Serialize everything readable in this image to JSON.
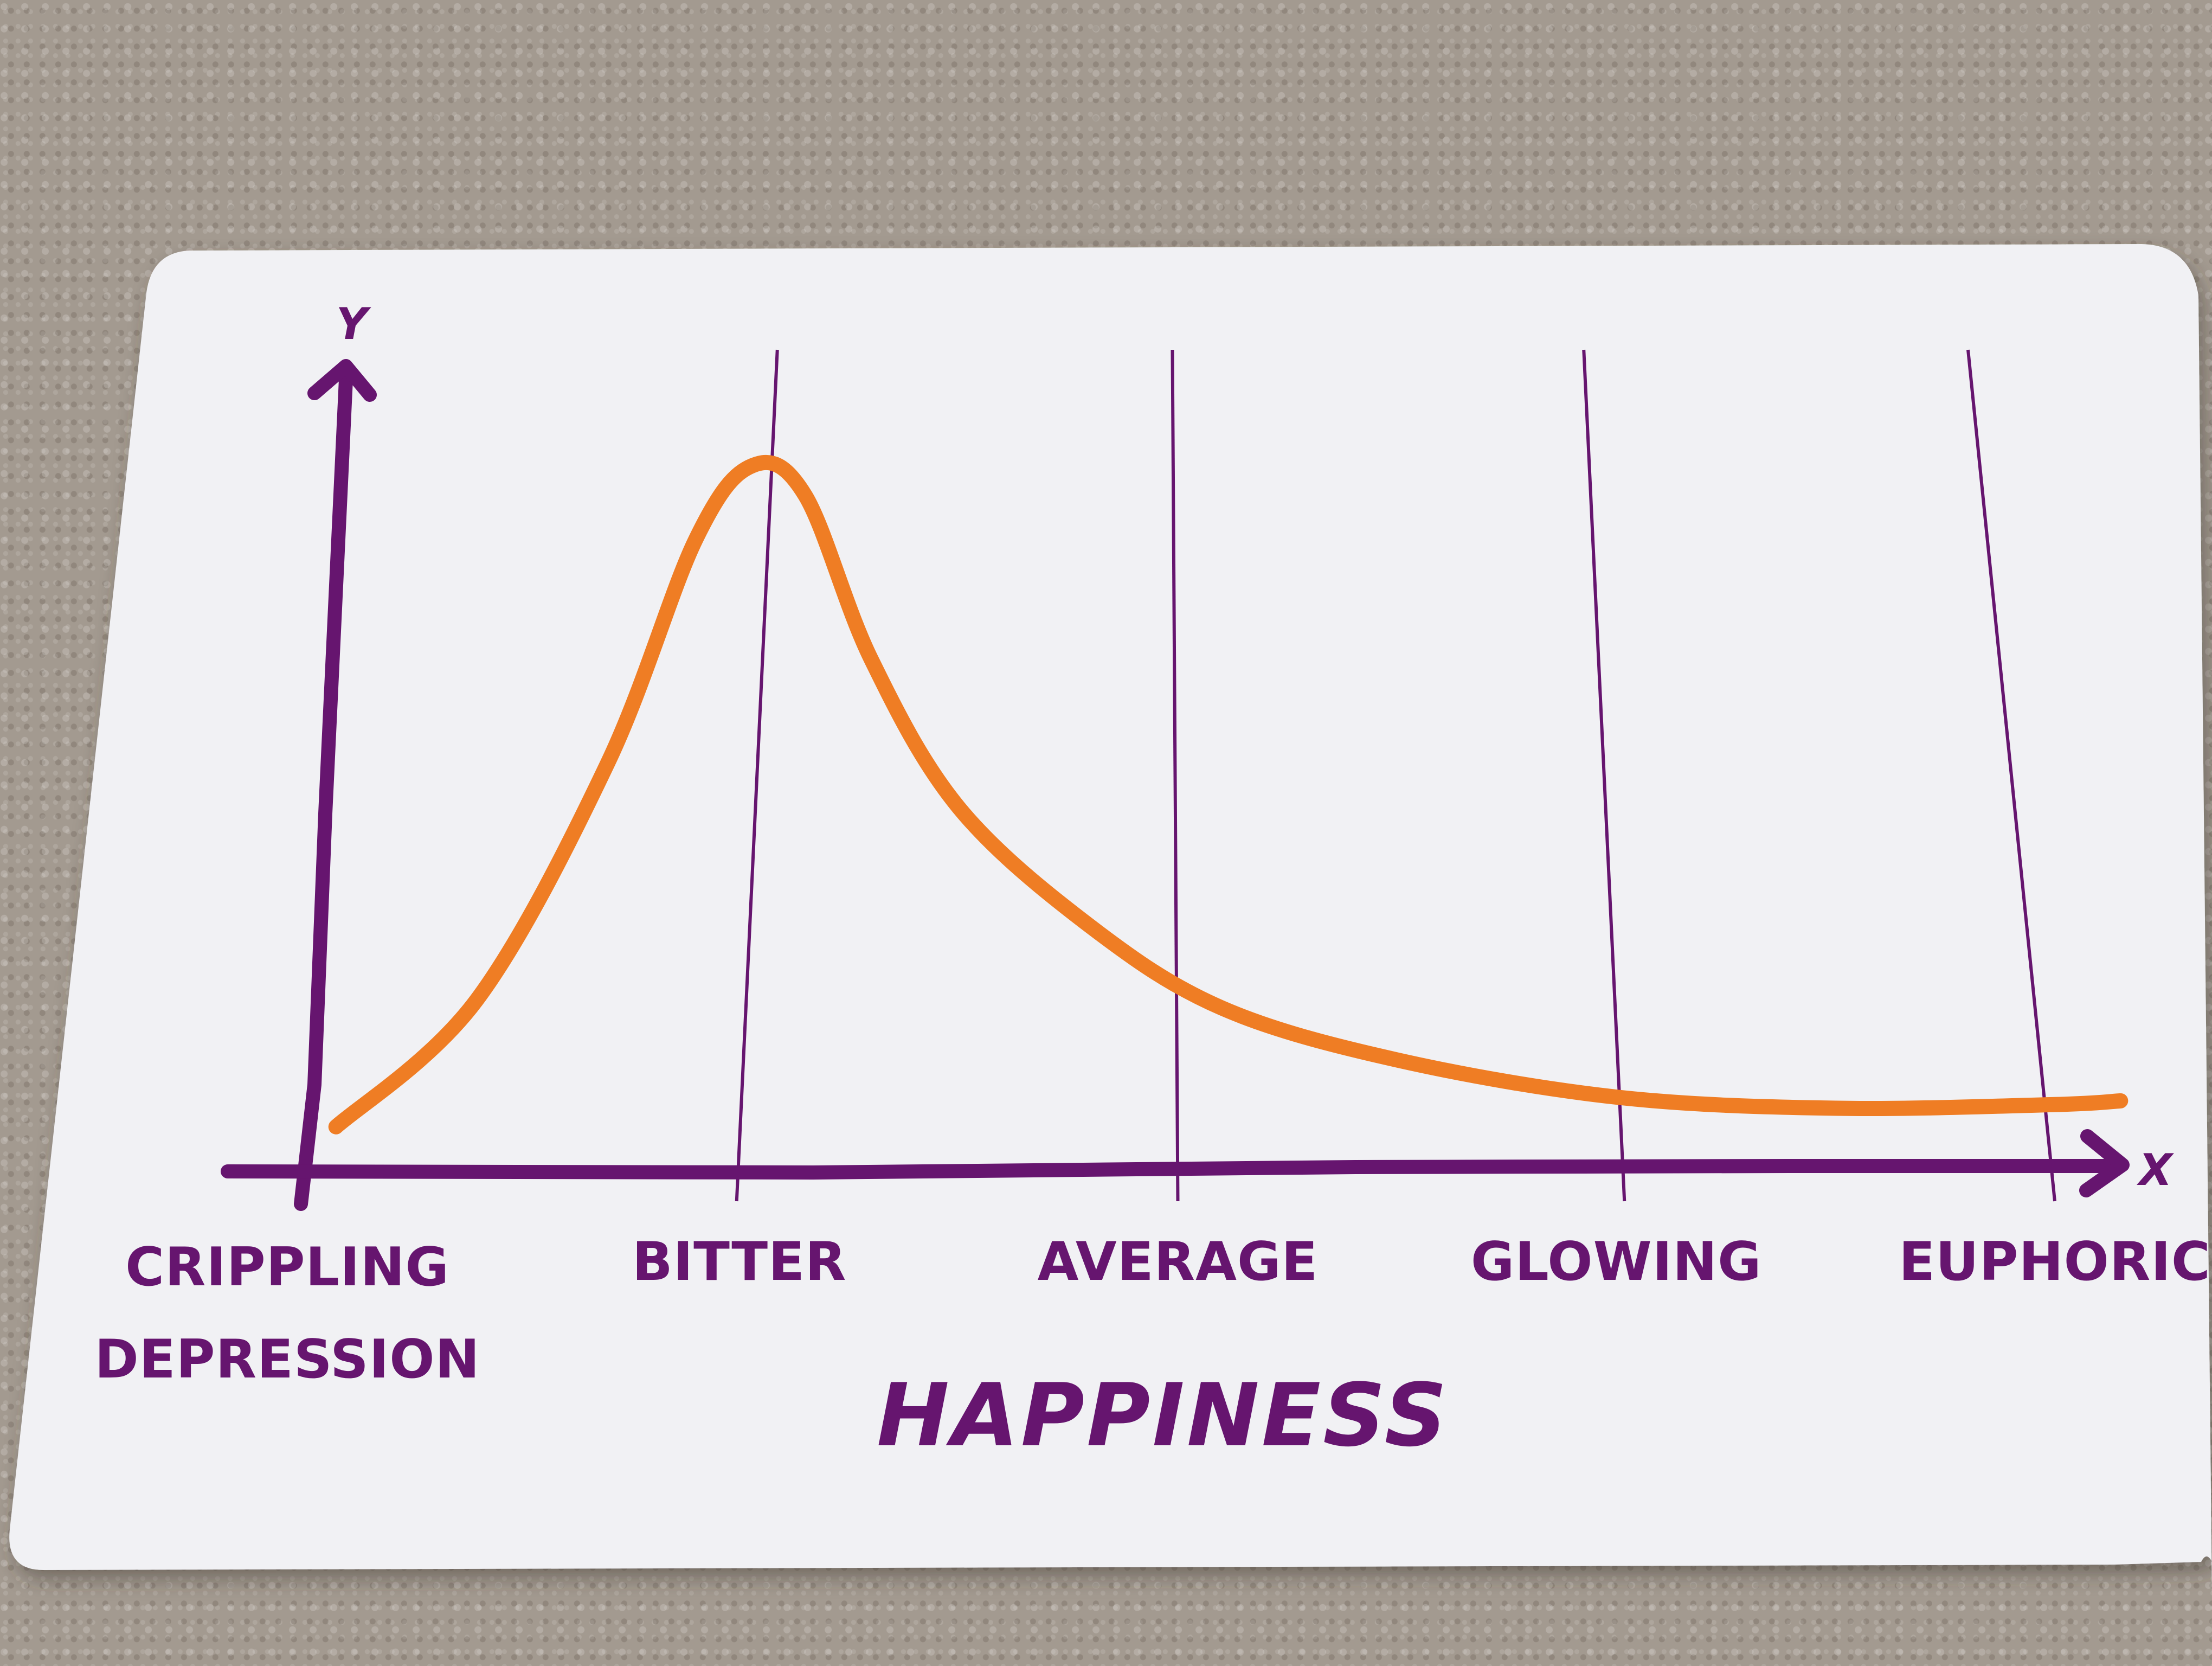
{
  "chart_data": {
    "type": "line",
    "title": "",
    "xlabel": "HAPPINESS",
    "ylabel": "",
    "x_axis_letter": "X",
    "y_axis_letter": "Y",
    "categories": [
      [
        "CRIPPLING",
        "DEPRESSION"
      ],
      [
        "BITTER"
      ],
      [
        "AVERAGE"
      ],
      [
        "GLOWING"
      ],
      [
        "EUPHORIC"
      ]
    ],
    "xlim": [
      0,
      4.15
    ],
    "ylim": [
      0,
      1
    ],
    "y_ticks_shown": false,
    "grid": "vertical lines at each category",
    "legend": "none",
    "series": [
      {
        "color": "#ef7d24",
        "x": [
          0.08,
          0.4,
          0.7,
          0.9,
          1.03,
          1.15,
          1.3,
          1.5,
          1.8,
          2.1,
          2.5,
          3.0,
          3.5,
          4.0,
          4.15
        ],
        "y": [
          0.06,
          0.23,
          0.55,
          0.85,
          0.95,
          0.91,
          0.69,
          0.49,
          0.33,
          0.22,
          0.15,
          0.1,
          0.085,
          0.09,
          0.095
        ]
      }
    ],
    "colors": {
      "axis": "#66156f",
      "curve": "#ef7d24",
      "card": "#f1f1f4",
      "background": "#a39a90"
    }
  }
}
